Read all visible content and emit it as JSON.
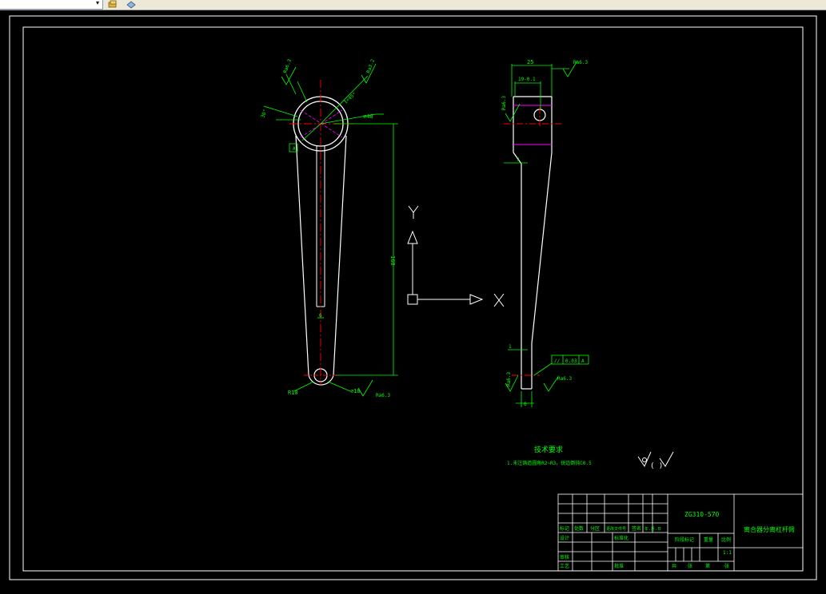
{
  "toolbar": {
    "layer_combo_value": "",
    "icons": [
      "layer-icon",
      "properties-icon"
    ]
  },
  "drawing": {
    "colors": {
      "background": "#000000",
      "outline": "#ffffff",
      "dimension": "#00ff00",
      "centerline": "#ff0000",
      "hidden": "#ff00ff"
    },
    "front_view": {
      "dims": {
        "big_bore": "⌀40",
        "small_bore": "⌀10",
        "total_length": "168",
        "web_width": "6",
        "bottom_width": "R10",
        "chamfer_top": "1×45°",
        "chamfer_left": "30°",
        "datum": "A"
      },
      "roughness": [
        "Ra6.3",
        "Ra3.2",
        "Ra6.3"
      ]
    },
    "side_view": {
      "dims": {
        "width_top": "25",
        "width_inner": "19-0.1",
        "step": "7",
        "bottom_width": "6",
        "bottom_step": "1"
      },
      "roughness": [
        "Ra6.3",
        "Ra6.3",
        "Ra6.3",
        "Ra6.3"
      ],
      "tolerance_frame": [
        "//",
        "0.03",
        "A"
      ]
    },
    "ucs": {
      "x_label": "X",
      "y_label": "Y"
    },
    "notes": {
      "title": "技术要求",
      "line1": "1.未注铸造圆角R2~R3，锐边倒钝C0.5"
    },
    "surface_symbol_note": "( )"
  },
  "title_block": {
    "drawing_number": "ZG310-570",
    "part_name": "离合器分离杠杆臂",
    "scale": "1:1",
    "labels": {
      "mark": "标记",
      "count": "处数",
      "zone": "分区",
      "doc_no": "更改文件号",
      "sign": "签名",
      "date": "年.月.日",
      "design": "设计",
      "standardize": "标准化",
      "review": "审核",
      "process": "工艺",
      "approve": "批准",
      "stage_mark": "阶段标记",
      "weight": "重量",
      "ratio": "比例",
      "total": "共",
      "sheets": "张",
      "page": "第",
      "sheet": "张"
    }
  }
}
